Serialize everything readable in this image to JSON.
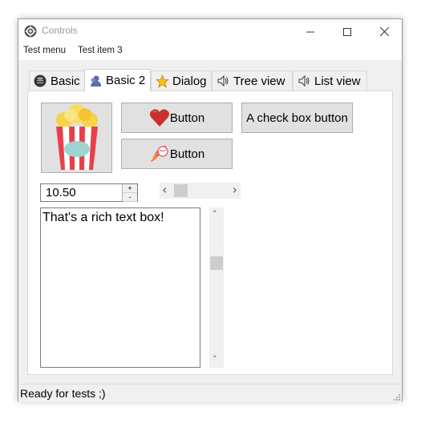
{
  "window": {
    "title": "Controls"
  },
  "menu": {
    "items": [
      "Test menu",
      "Test item 3"
    ]
  },
  "tabs": [
    {
      "label": "Basic",
      "icon": "database-icon",
      "active": false
    },
    {
      "label": "Basic 2",
      "icon": "user-icon",
      "active": true
    },
    {
      "label": "Dialog",
      "icon": "star-icon",
      "active": false
    },
    {
      "label": "Tree view",
      "icon": "speaker-icon",
      "active": false
    },
    {
      "label": "List view",
      "icon": "speaker-icon",
      "active": false
    }
  ],
  "buttons": {
    "heart_button": "Button",
    "fire_button": "Button",
    "checkbox_button": "A check box button"
  },
  "numeric": {
    "value": "10.50",
    "up": "+",
    "down": "-"
  },
  "richtext": {
    "content": "That's a rich text box!"
  },
  "scroll": {
    "left": "‹",
    "right": "›",
    "up": "˄",
    "down": "˅"
  },
  "status": {
    "text": "Ready for tests ;)"
  }
}
